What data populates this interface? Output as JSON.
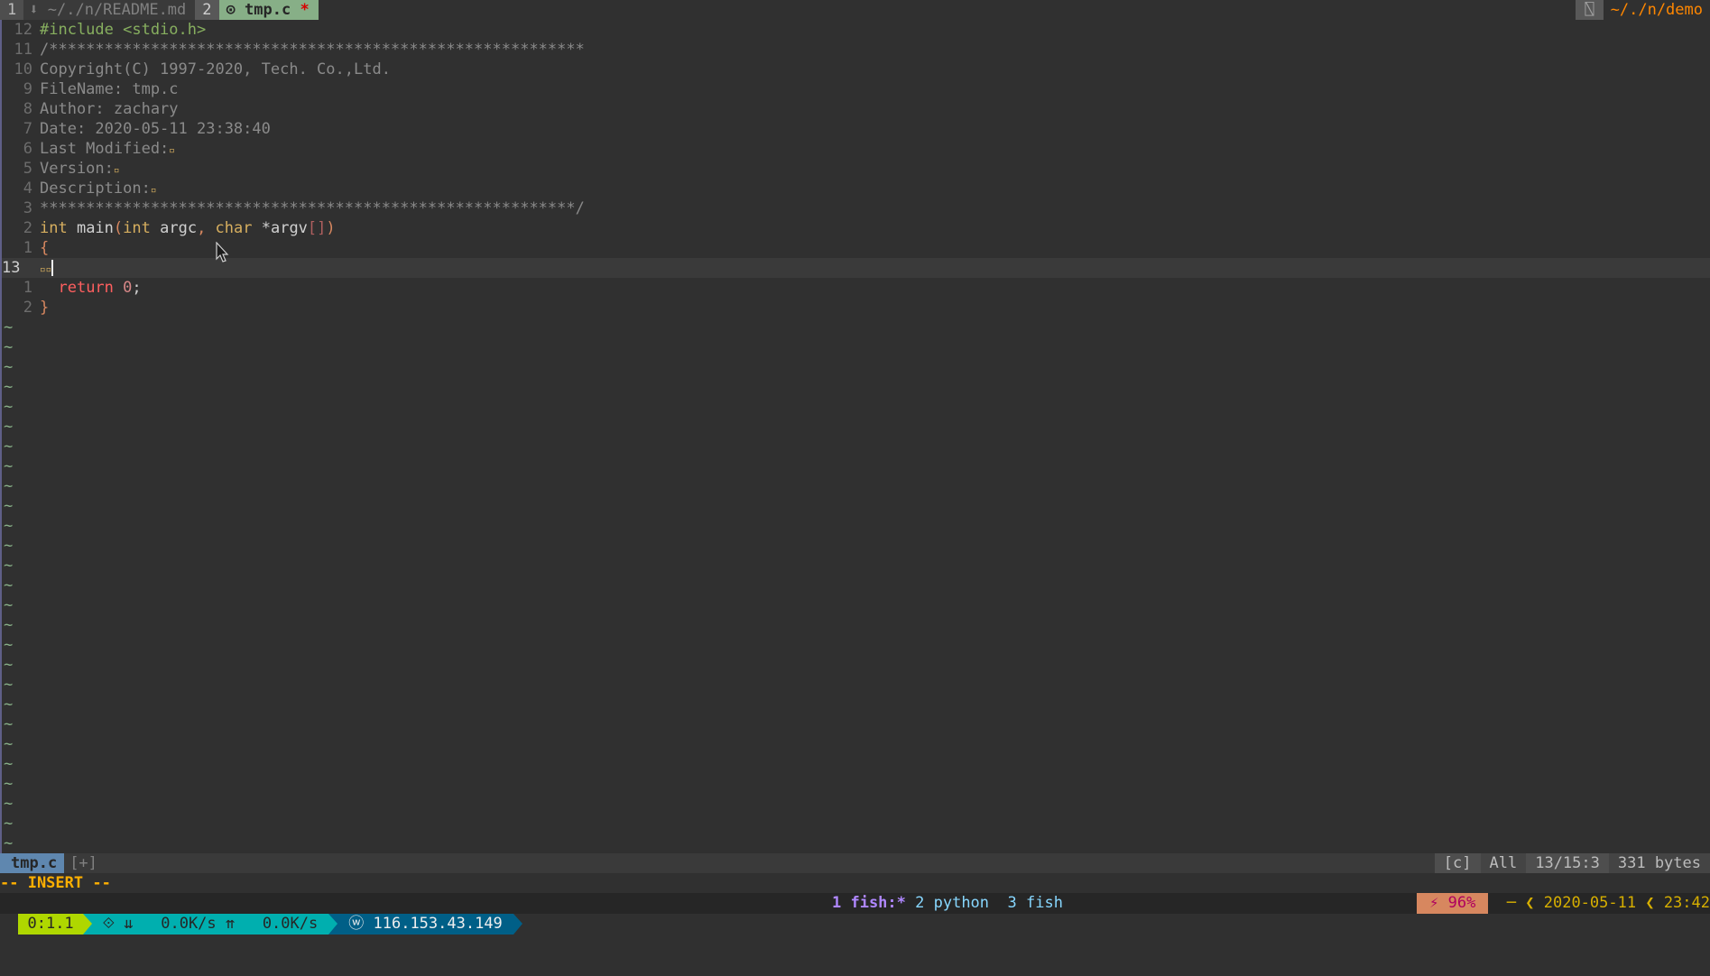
{
  "tabline": {
    "tabs": [
      {
        "num": "1",
        "icon": "⬇",
        "label": "~/./n/README.md"
      },
      {
        "num": "2",
        "icon": "⊙",
        "label": "tmp.c",
        "modified": "*"
      }
    ],
    "right_icon": "⍂",
    "cwd": "~/./n/demo"
  },
  "editor": {
    "lines": [
      {
        "num": "12",
        "text": "#include <stdio.h>"
      },
      {
        "num": "11",
        "text": "/**********************************************************"
      },
      {
        "num": "10",
        "text": "Copyright(C) 1997-2020, Tech. Co.,Ltd."
      },
      {
        "num": "9",
        "text": "FileName: tmp.c"
      },
      {
        "num": "8",
        "text": "Author: zachary"
      },
      {
        "num": "7",
        "text": "Date: 2020-05-11 23:38:40"
      },
      {
        "num": "6",
        "text": "Last Modified:"
      },
      {
        "num": "5",
        "text": "Version:"
      },
      {
        "num": "4",
        "text": "Description:"
      },
      {
        "num": "3",
        "text": "**********************************************************/"
      },
      {
        "num": "2",
        "text": "int main(int argc, char *argv[])"
      },
      {
        "num": "1",
        "text": "{"
      },
      {
        "num": "13",
        "text": ""
      },
      {
        "num": "1",
        "text": "  return 0;"
      },
      {
        "num": "2",
        "text": "}"
      }
    ],
    "tilde": "~"
  },
  "statusline": {
    "filename": "tmp.c",
    "modified": "[+]",
    "filetype": "[c]",
    "position": "All",
    "cursor": "13/15:3",
    "size": "331 bytes"
  },
  "cmdline": "-- INSERT --",
  "tmux": {
    "session": "0:1.1",
    "net": "⟐ ⇊   0.0K/s ⇈   0.0K/s",
    "ip": "116.153.43.149",
    "windows": [
      {
        "label": "1 fish:*",
        "current": true
      },
      {
        "label": "2 python"
      },
      {
        "label": "3 fish"
      }
    ],
    "battery": "96%",
    "date": "2020-05-11",
    "time": "23:42"
  }
}
